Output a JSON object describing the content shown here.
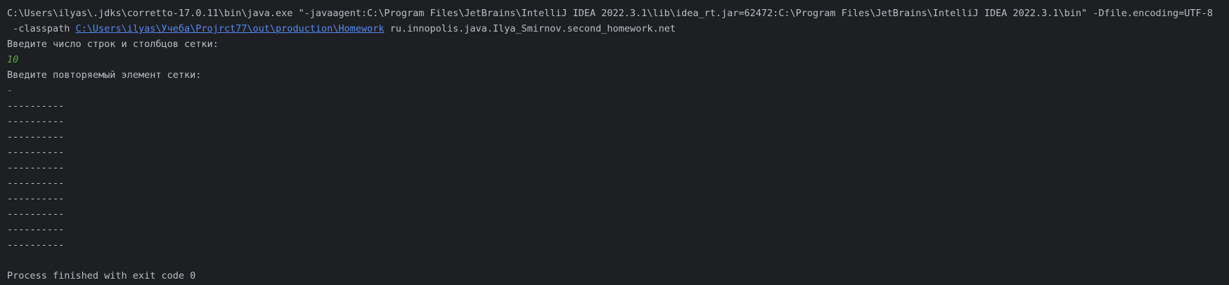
{
  "command": {
    "line1": "C:\\Users\\ilyas\\.jdks\\corretto-17.0.11\\bin\\java.exe \"-javaagent:C:\\Program Files\\JetBrains\\IntelliJ IDEA 2022.3.1\\lib\\idea_rt.jar=62472:C:\\Program Files\\JetBrains\\IntelliJ IDEA 2022.3.1\\bin\" -Dfile.encoding=UTF-8",
    "classpath_prefix": " -classpath ",
    "classpath_link": "C:\\Users\\ilyas\\Учеба\\Projrct77\\out\\production\\Homework",
    "main_class": " ru.innopolis.java.Ilya_Smirnov.second_homework.net"
  },
  "output": {
    "prompt_rows_cols": "Введите число строк и столбцов сетки:",
    "input_size": "10",
    "prompt_element": "Введите повторяемый элемент сетки:",
    "input_element": "-",
    "grid_rows": [
      "----------",
      "----------",
      "----------",
      "----------",
      "----------",
      "----------",
      "----------",
      "----------",
      "----------",
      "----------"
    ],
    "exit_message": "Process finished with exit code 0"
  },
  "colors": {
    "background": "#1e1f22",
    "text": "#bcbec4",
    "link": "#548af7",
    "user_input": "#57a64a"
  }
}
